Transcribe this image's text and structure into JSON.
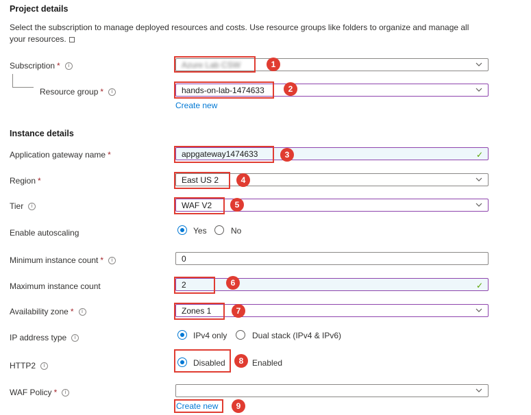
{
  "project": {
    "title": "Project details",
    "description": "Select the subscription to manage deployed resources and costs. Use resource groups like folders to organize and manage all your resources."
  },
  "subscription": {
    "label": "Subscription",
    "required": "*",
    "value": "Azure Lab CSW"
  },
  "resource_group": {
    "label": "Resource group",
    "required": "*",
    "value": "hands-on-lab-1474633",
    "create_new": "Create new"
  },
  "instance": {
    "title": "Instance details"
  },
  "gateway_name": {
    "label": "Application gateway name",
    "required": "*",
    "value": "appgateway1474633"
  },
  "region": {
    "label": "Region",
    "required": "*",
    "value": "East US 2"
  },
  "tier": {
    "label": "Tier",
    "value": "WAF V2"
  },
  "autoscaling": {
    "label": "Enable autoscaling",
    "options": [
      "Yes",
      "No"
    ],
    "selected": "Yes"
  },
  "min_count": {
    "label": "Minimum instance count",
    "required": "*",
    "value": "0"
  },
  "max_count": {
    "label": "Maximum instance count",
    "value": "2"
  },
  "availability_zone": {
    "label": "Availability zone",
    "required": "*",
    "value": "Zones 1"
  },
  "ip_type": {
    "label": "IP address type",
    "options": [
      "IPv4 only",
      "Dual stack (IPv4 & IPv6)"
    ],
    "selected": "IPv4 only"
  },
  "http2": {
    "label": "HTTP2",
    "options": [
      "Disabled",
      "Enabled"
    ],
    "selected": "Disabled"
  },
  "waf_policy": {
    "label": "WAF Policy",
    "required": "*",
    "value": "",
    "create_new": "Create new"
  },
  "badges": [
    "1",
    "2",
    "3",
    "4",
    "5",
    "6",
    "7",
    "8",
    "9"
  ],
  "icons": {
    "info": "info-icon",
    "chevron": "chevron-down-icon",
    "check": "checkmark-icon",
    "external": "external-link-icon"
  },
  "colors": {
    "accent": "#0078d4",
    "annotation": "#e03c31",
    "active_border": "#8e44ad",
    "valid": "#57a300",
    "required": "#a4262c"
  }
}
